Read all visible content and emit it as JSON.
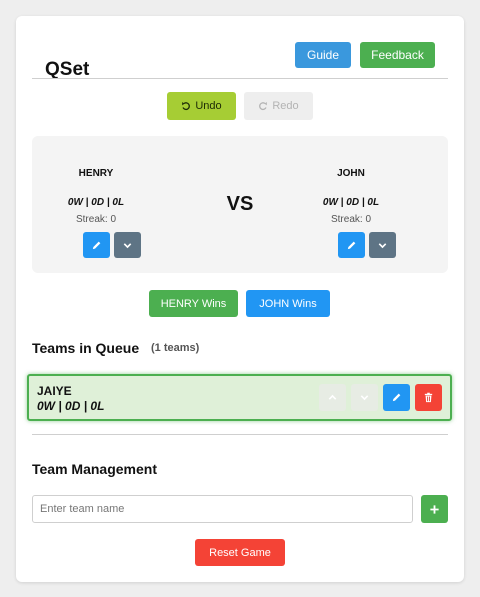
{
  "app": {
    "title": "QSet"
  },
  "header": {
    "guide_label": "Guide",
    "feedback_label": "Feedback"
  },
  "history": {
    "undo_label": "Undo",
    "redo_label": "Redo"
  },
  "match": {
    "vs_label": "VS",
    "left": {
      "name": "HENRY",
      "record": "0W | 0D | 0L",
      "streak": "Streak: 0"
    },
    "right": {
      "name": "JOHN",
      "record": "0W | 0D | 0L",
      "streak": "Streak: 0"
    }
  },
  "result_buttons": {
    "left_wins": "HENRY Wins",
    "right_wins": "JOHN Wins"
  },
  "queue": {
    "title": "Teams in Queue",
    "count": "(1 teams)",
    "items": [
      {
        "name": "JAIYE",
        "record": "0W | 0D | 0L"
      }
    ]
  },
  "management": {
    "title": "Team Management",
    "input_placeholder": "Enter team name",
    "reset_label": "Reset Game"
  },
  "colors": {
    "primary_blue": "#2196f3",
    "success_green": "#4caf50",
    "danger_red": "#f44336",
    "undo_lime": "#a6cd34",
    "slate": "#5e7485"
  },
  "icons": {
    "undo": "undo-icon",
    "redo": "redo-icon",
    "edit": "pencil-icon",
    "expand": "chevron-down-icon",
    "move_up": "chevron-up-icon",
    "move_down": "chevron-down-icon",
    "delete": "trash-icon",
    "add": "plus-icon"
  }
}
